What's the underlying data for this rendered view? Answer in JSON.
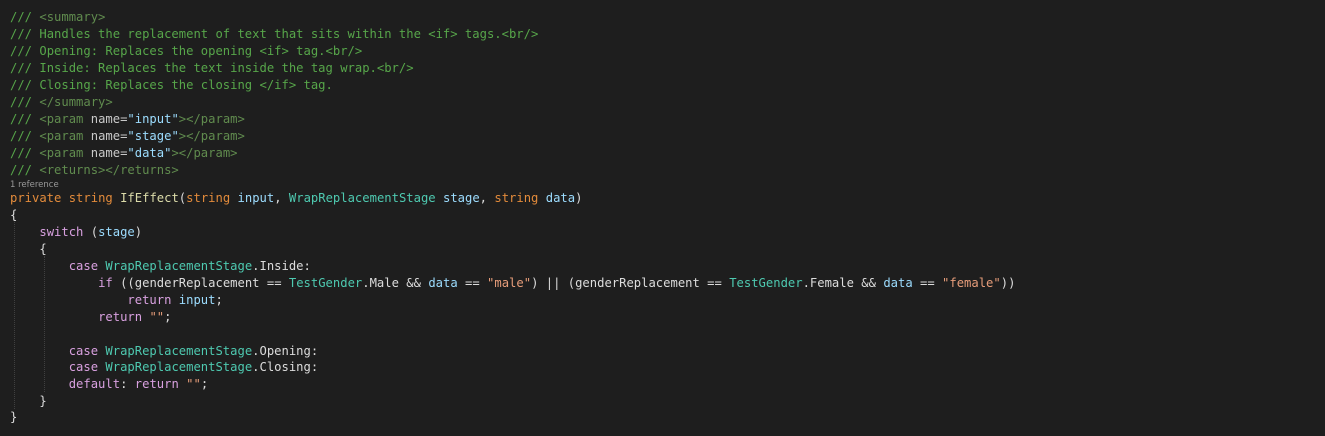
{
  "doc_comments": [
    {
      "prefix": "/// ",
      "text": "<summary>"
    },
    {
      "prefix": "/// ",
      "text": "Handles the replacement of text that sits within the <if> tags.<br/>"
    },
    {
      "prefix": "/// ",
      "text": "Opening: Replaces the opening <if> tag.<br/>"
    },
    {
      "prefix": "/// ",
      "text": "Inside: Replaces the text inside the tag wrap.<br/>"
    },
    {
      "prefix": "/// ",
      "text": "Closing: Replaces the closing </if> tag."
    },
    {
      "prefix": "/// ",
      "text": "</summary>"
    }
  ],
  "params_doc": [
    {
      "open": "<param ",
      "attr": "name=",
      "value": "\"input\"",
      "close": "></param>"
    },
    {
      "open": "<param ",
      "attr": "name=",
      "value": "\"stage\"",
      "close": "></param>"
    },
    {
      "open": "<param ",
      "attr": "name=",
      "value": "\"data\"",
      "close": "></param>"
    }
  ],
  "returns_doc": "<returns></returns>",
  "comment_prefix": "/// ",
  "codelens": "1 reference",
  "signature": {
    "modifier": "private",
    "return_type": "string",
    "method": "IfEffect",
    "p1_type": "string",
    "p1_name": "input",
    "p2_type": "WrapReplacementStage",
    "p2_name": "stage",
    "p3_type": "string",
    "p3_name": "data"
  },
  "code": {
    "open_brace": "{",
    "close_brace": "}",
    "switch_kw": "switch",
    "switch_var": "stage",
    "case_kw": "case",
    "enum_type": "WrapReplacementStage",
    "inside": "Inside",
    "opening": "Opening",
    "closing": "Closing",
    "if_kw": "if",
    "gender_field": "genderReplacement",
    "gender_type": "TestGender",
    "male": "Male",
    "female": "Female",
    "data_var": "data",
    "male_str": "\"male\"",
    "female_str": "\"female\"",
    "return_kw": "return",
    "input_var": "input",
    "empty_str": "\"\"",
    "default_kw": "default"
  }
}
